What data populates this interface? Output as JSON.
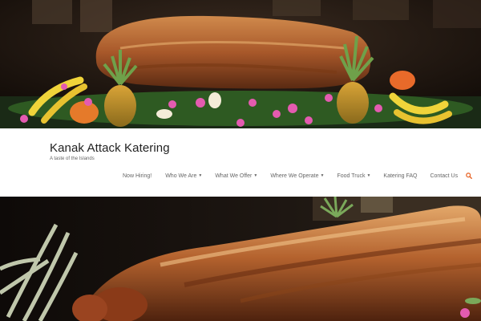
{
  "site": {
    "title": "Kanak Attack Katering",
    "tagline": "A taste of the Islands"
  },
  "nav": {
    "items": [
      {
        "label": "Now Hiring!",
        "dropdown": false
      },
      {
        "label": "Who We Are",
        "dropdown": true
      },
      {
        "label": "What We Offer",
        "dropdown": true
      },
      {
        "label": "Where We Operate",
        "dropdown": true
      },
      {
        "label": "Food Truck",
        "dropdown": true
      },
      {
        "label": "Katering FAQ",
        "dropdown": false
      },
      {
        "label": "Contact Us",
        "dropdown": false
      }
    ],
    "search_icon": "search-icon",
    "accent_color": "#e8682c"
  },
  "images": {
    "banner_top": "roast-pig-buffet-photo",
    "banner_bottom": "roast-pig-closeup-photo"
  }
}
